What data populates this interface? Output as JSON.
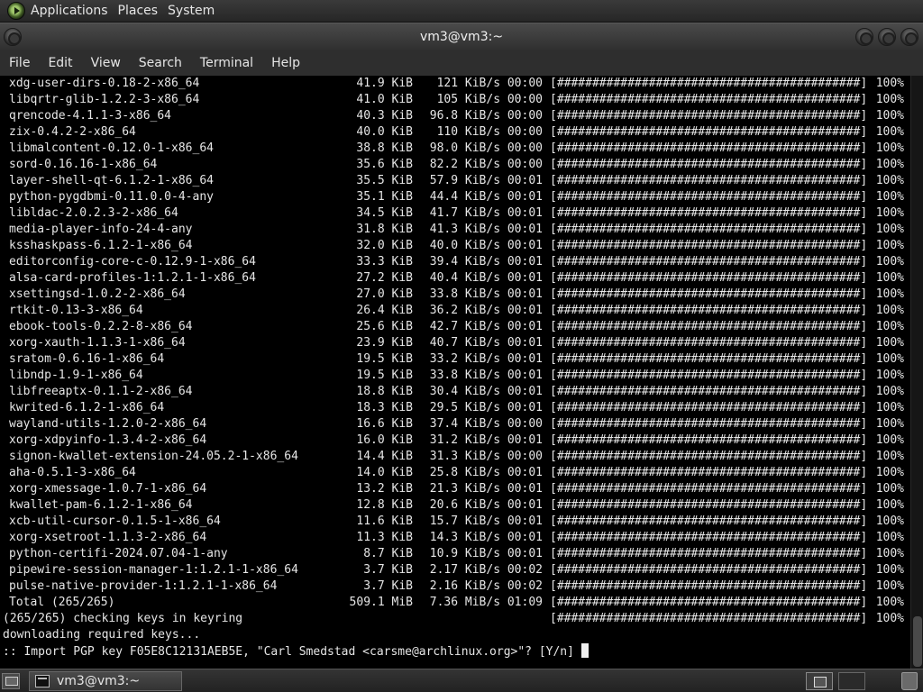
{
  "top_panel": {
    "menus": [
      "Applications",
      "Places",
      "System"
    ]
  },
  "window": {
    "title": "vm3@vm3:~",
    "menu": [
      "File",
      "Edit",
      "View",
      "Search",
      "Terminal",
      "Help"
    ]
  },
  "terminal": {
    "progress_bar": "[###########################################]",
    "rows": [
      {
        "name": "xdg-user-dirs-0.18-2-x86_64",
        "size": "41.9 KiB",
        "rate": "121 KiB/s 00:00",
        "pct": "100%"
      },
      {
        "name": "libqrtr-glib-1.2.2-3-x86_64",
        "size": "41.0 KiB",
        "rate": "105 KiB/s 00:00",
        "pct": "100%"
      },
      {
        "name": "qrencode-4.1.1-3-x86_64",
        "size": "40.3 KiB",
        "rate": "96.8 KiB/s 00:00",
        "pct": "100%"
      },
      {
        "name": "zix-0.4.2-2-x86_64",
        "size": "40.0 KiB",
        "rate": "110 KiB/s 00:00",
        "pct": "100%"
      },
      {
        "name": "libmalcontent-0.12.0-1-x86_64",
        "size": "38.8 KiB",
        "rate": "98.0 KiB/s 00:00",
        "pct": "100%"
      },
      {
        "name": "sord-0.16.16-1-x86_64",
        "size": "35.6 KiB",
        "rate": "82.2 KiB/s 00:00",
        "pct": "100%"
      },
      {
        "name": "layer-shell-qt-6.1.2-1-x86_64",
        "size": "35.5 KiB",
        "rate": "57.9 KiB/s 00:01",
        "pct": "100%"
      },
      {
        "name": "python-pygdbmi-0.11.0.0-4-any",
        "size": "35.1 KiB",
        "rate": "44.4 KiB/s 00:01",
        "pct": "100%"
      },
      {
        "name": "libldac-2.0.2.3-2-x86_64",
        "size": "34.5 KiB",
        "rate": "41.7 KiB/s 00:01",
        "pct": "100%"
      },
      {
        "name": "media-player-info-24-4-any",
        "size": "31.8 KiB",
        "rate": "41.3 KiB/s 00:01",
        "pct": "100%"
      },
      {
        "name": "ksshaskpass-6.1.2-1-x86_64",
        "size": "32.0 KiB",
        "rate": "40.0 KiB/s 00:01",
        "pct": "100%"
      },
      {
        "name": "editorconfig-core-c-0.12.9-1-x86_64",
        "size": "33.3 KiB",
        "rate": "39.4 KiB/s 00:01",
        "pct": "100%"
      },
      {
        "name": "alsa-card-profiles-1:1.2.1-1-x86_64",
        "size": "27.2 KiB",
        "rate": "40.4 KiB/s 00:01",
        "pct": "100%"
      },
      {
        "name": "xsettingsd-1.0.2-2-x86_64",
        "size": "27.0 KiB",
        "rate": "33.8 KiB/s 00:01",
        "pct": "100%"
      },
      {
        "name": "rtkit-0.13-3-x86_64",
        "size": "26.4 KiB",
        "rate": "36.2 KiB/s 00:01",
        "pct": "100%"
      },
      {
        "name": "ebook-tools-0.2.2-8-x86_64",
        "size": "25.6 KiB",
        "rate": "42.7 KiB/s 00:01",
        "pct": "100%"
      },
      {
        "name": "xorg-xauth-1.1.3-1-x86_64",
        "size": "23.9 KiB",
        "rate": "40.7 KiB/s 00:01",
        "pct": "100%"
      },
      {
        "name": "sratom-0.6.16-1-x86_64",
        "size": "19.5 KiB",
        "rate": "33.2 KiB/s 00:01",
        "pct": "100%"
      },
      {
        "name": "libndp-1.9-1-x86_64",
        "size": "19.5 KiB",
        "rate": "33.8 KiB/s 00:01",
        "pct": "100%"
      },
      {
        "name": "libfreeaptx-0.1.1-2-x86_64",
        "size": "18.8 KiB",
        "rate": "30.4 KiB/s 00:01",
        "pct": "100%"
      },
      {
        "name": "kwrited-6.1.2-1-x86_64",
        "size": "18.3 KiB",
        "rate": "29.5 KiB/s 00:01",
        "pct": "100%"
      },
      {
        "name": "wayland-utils-1.2.0-2-x86_64",
        "size": "16.6 KiB",
        "rate": "37.4 KiB/s 00:00",
        "pct": "100%"
      },
      {
        "name": "xorg-xdpyinfo-1.3.4-2-x86_64",
        "size": "16.0 KiB",
        "rate": "31.2 KiB/s 00:01",
        "pct": "100%"
      },
      {
        "name": "signon-kwallet-extension-24.05.2-1-x86_64",
        "size": "14.4 KiB",
        "rate": "31.3 KiB/s 00:00",
        "pct": "100%"
      },
      {
        "name": "aha-0.5.1-3-x86_64",
        "size": "14.0 KiB",
        "rate": "25.8 KiB/s 00:01",
        "pct": "100%"
      },
      {
        "name": "xorg-xmessage-1.0.7-1-x86_64",
        "size": "13.2 KiB",
        "rate": "21.3 KiB/s 00:01",
        "pct": "100%"
      },
      {
        "name": "kwallet-pam-6.1.2-1-x86_64",
        "size": "12.8 KiB",
        "rate": "20.6 KiB/s 00:01",
        "pct": "100%"
      },
      {
        "name": "xcb-util-cursor-0.1.5-1-x86_64",
        "size": "11.6 KiB",
        "rate": "15.7 KiB/s 00:01",
        "pct": "100%"
      },
      {
        "name": "xorg-xsetroot-1.1.3-2-x86_64",
        "size": "11.3 KiB",
        "rate": "14.3 KiB/s 00:01",
        "pct": "100%"
      },
      {
        "name": "python-certifi-2024.07.04-1-any",
        "size": "8.7 KiB",
        "rate": "10.9 KiB/s 00:01",
        "pct": "100%"
      },
      {
        "name": "pipewire-session-manager-1:1.2.1-1-x86_64",
        "size": "3.7 KiB",
        "rate": "2.17 KiB/s 00:02",
        "pct": "100%"
      },
      {
        "name": "pulse-native-provider-1:1.2.1-1-x86_64",
        "size": "3.7 KiB",
        "rate": "2.16 KiB/s 00:02",
        "pct": "100%"
      }
    ],
    "total": {
      "name": "Total (265/265)",
      "size": "509.1 MiB",
      "rate": "7.36 MiB/s 01:09",
      "pct": "100%"
    },
    "checking": {
      "text": "(265/265) checking keys in keyring",
      "pct": "100%"
    },
    "downloading": "downloading required keys...",
    "prompt": ":: Import PGP key F05E8C12131AEB5E, \"Carl Smedstad <carsme@archlinux.org>\"? [Y/n] "
  },
  "taskbar": {
    "task_label": "vm3@vm3:~"
  }
}
